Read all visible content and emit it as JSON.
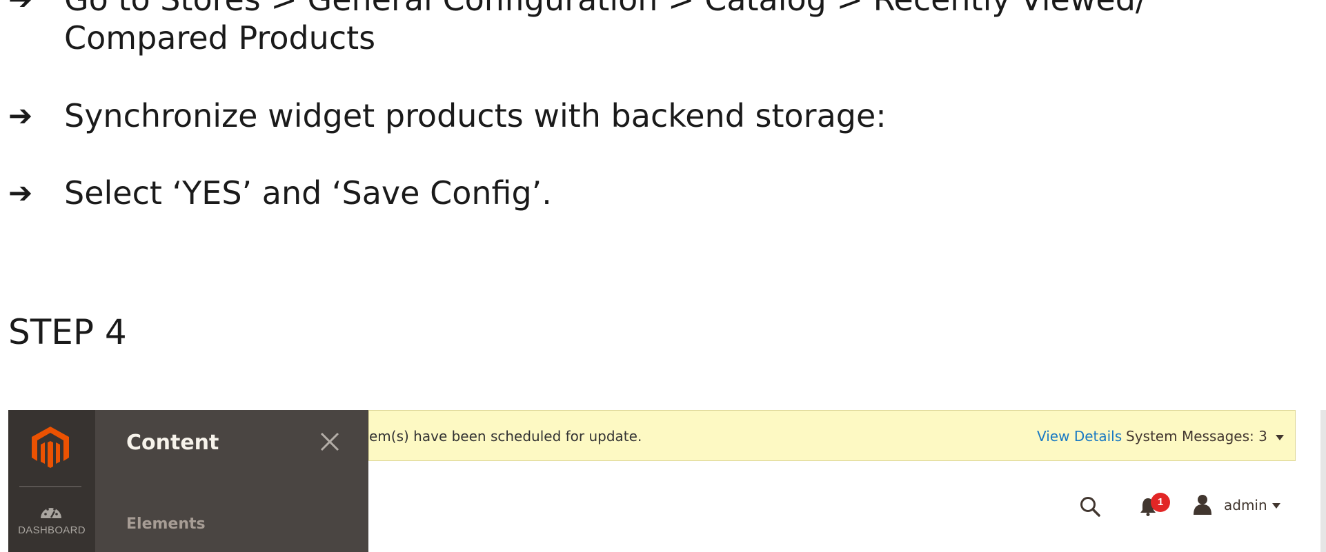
{
  "steps": [
    {
      "arrow": "➔",
      "line1": "Go to Stores > General Configuration > Catalog > Recently Viewed/",
      "line2": "Compared Products"
    },
    {
      "arrow": "➔",
      "text": "Synchronize widget products with backend storage:"
    },
    {
      "arrow": "➔",
      "text": "Select ‘YES’ and ‘Save Config’."
    }
  ],
  "heading": "STEP 4",
  "screenshot": {
    "sidebar": {
      "logo_icon": "magento-logo-icon",
      "dashboard_label": "DASHBOARD",
      "dashboard_icon": "speedometer-icon"
    },
    "menu_panel": {
      "title": "Content",
      "items": [
        {
          "label": "Elements"
        }
      ],
      "close_icon": "close-icon"
    },
    "notice": {
      "message": "em(s) have been scheduled for update.",
      "view_details": "View Details",
      "system_messages": "System Messages: 3"
    },
    "header": {
      "search_icon": "search-icon",
      "notifications_count": "1",
      "user_name": "admin"
    },
    "colors": {
      "sidebar_bg": "#373330",
      "menu_bg": "#4a4542",
      "logo": "#eb5202",
      "notice_bg": "#fdf9c3",
      "link": "#1979c3",
      "badge": "#e22626"
    }
  }
}
